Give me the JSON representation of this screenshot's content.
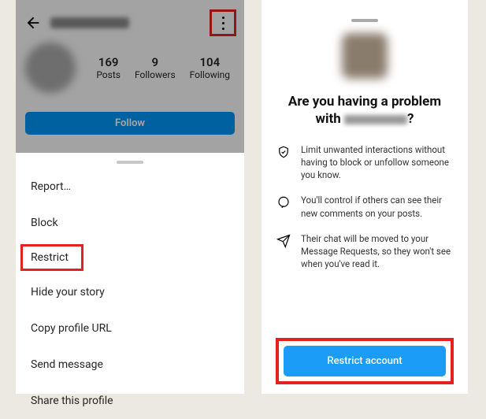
{
  "left": {
    "stats": {
      "posts": {
        "num": "169",
        "label": "Posts"
      },
      "followers": {
        "num": "9",
        "label": "Followers"
      },
      "following": {
        "num": "104",
        "label": "Following"
      }
    },
    "follow": "Follow",
    "menu": {
      "report": "Report…",
      "block": "Block",
      "restrict": "Restrict",
      "hide": "Hide your story",
      "copy": "Copy profile URL",
      "send": "Send message",
      "share": "Share this profile"
    }
  },
  "right": {
    "question_prefix": "Are you having a problem with",
    "question_suffix": "?",
    "b1": "Limit unwanted interactions without having to block or unfollow someone you know.",
    "b2": "You'll control if others can see their new comments on your posts.",
    "b3": "Their chat will be moved to your Message Requests, so they won't see when you've read it.",
    "restrict": "Restrict account"
  }
}
